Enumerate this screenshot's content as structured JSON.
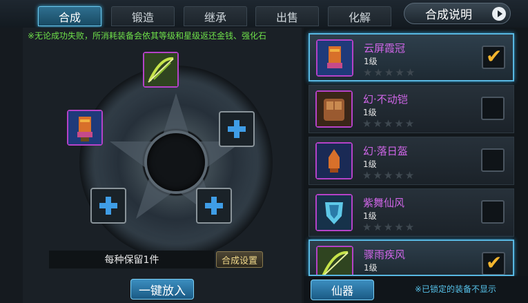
{
  "tabs": [
    "合成",
    "锻造",
    "继承",
    "出售",
    "化解"
  ],
  "help_button": "合成说明",
  "notice": "※无论成功失败，所消耗装备会依其等级和星级返还金钱、强化石",
  "keep_label": "每种保留1件",
  "setting_button": "合成设置",
  "put_button": "一键放入",
  "fairy_button": "仙器",
  "lock_note": "※已锁定的装备不显示",
  "slots": [
    {
      "icon": "bow-icon"
    },
    {
      "icon": "helmet-icon"
    },
    {
      "icon": "plus-icon"
    },
    {
      "icon": "plus-icon"
    },
    {
      "icon": "plus-icon"
    }
  ],
  "equipment": [
    {
      "name": "云屏霞冠",
      "level": "1级",
      "stars": "★★★★★",
      "icon": "helmet-icon",
      "checked": true
    },
    {
      "name": "幻·不动铠",
      "level": "1级",
      "stars": "★★★★★",
      "icon": "armor-icon",
      "checked": false
    },
    {
      "name": "幻·落日盔",
      "level": "1级",
      "stars": "★★★★★",
      "icon": "helmet-icon",
      "checked": false
    },
    {
      "name": "紫舞仙风",
      "level": "1级",
      "stars": "★★★★★",
      "icon": "shield-icon",
      "checked": false
    },
    {
      "name": "骤雨疾风",
      "level": "1级",
      "stars": "★★★★★",
      "icon": "bow-icon",
      "checked": true
    }
  ],
  "colors": {
    "accent": "#58b8e2",
    "item_name": "#d066e8",
    "notice": "#6fe04a",
    "check": "#f3b52e"
  }
}
